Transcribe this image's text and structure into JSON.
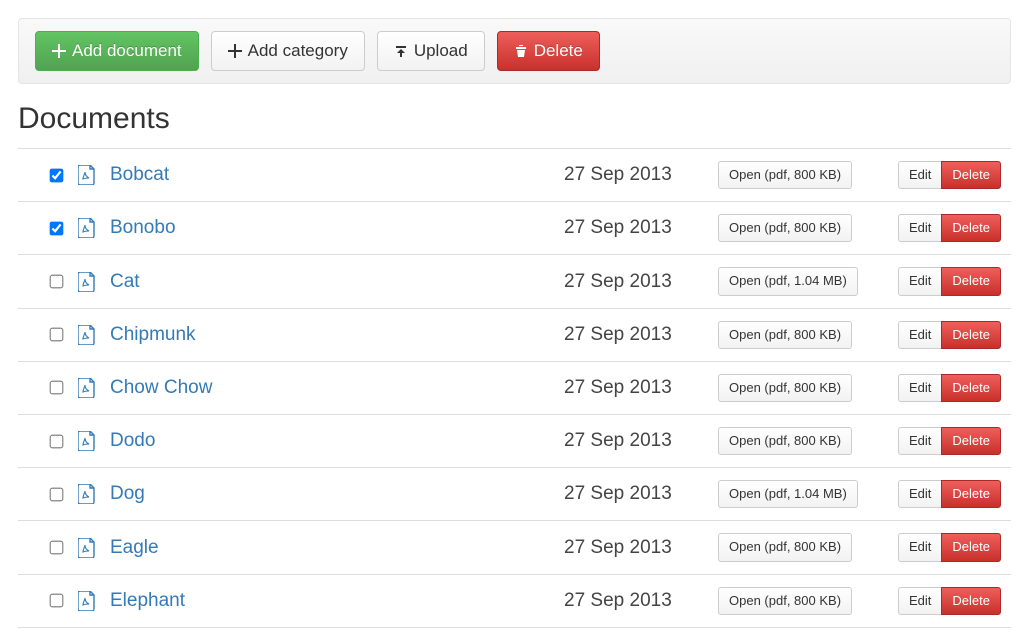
{
  "toolbar": {
    "add_document": "Add document",
    "add_category": "Add category",
    "upload": "Upload",
    "delete": "Delete"
  },
  "page_title": "Documents",
  "row_labels": {
    "open_prefix": "Open",
    "edit": "Edit",
    "delete": "Delete"
  },
  "documents": [
    {
      "name": "Bobcat",
      "date": "27 Sep 2013",
      "open": "Open (pdf, 800 KB)",
      "checked": true
    },
    {
      "name": "Bonobo",
      "date": "27 Sep 2013",
      "open": "Open (pdf, 800 KB)",
      "checked": true
    },
    {
      "name": "Cat",
      "date": "27 Sep 2013",
      "open": "Open (pdf, 1.04 MB)",
      "checked": false
    },
    {
      "name": "Chipmunk",
      "date": "27 Sep 2013",
      "open": "Open (pdf, 800 KB)",
      "checked": false
    },
    {
      "name": "Chow Chow",
      "date": "27 Sep 2013",
      "open": "Open (pdf, 800 KB)",
      "checked": false
    },
    {
      "name": "Dodo",
      "date": "27 Sep 2013",
      "open": "Open (pdf, 800 KB)",
      "checked": false
    },
    {
      "name": "Dog",
      "date": "27 Sep 2013",
      "open": "Open (pdf, 1.04 MB)",
      "checked": false
    },
    {
      "name": "Eagle",
      "date": "27 Sep 2013",
      "open": "Open (pdf, 800 KB)",
      "checked": false
    },
    {
      "name": "Elephant",
      "date": "27 Sep 2013",
      "open": "Open (pdf, 800 KB)",
      "checked": false
    }
  ]
}
